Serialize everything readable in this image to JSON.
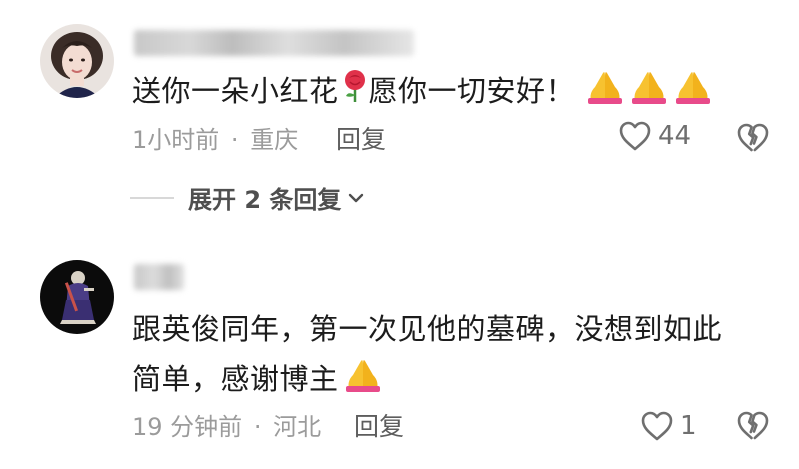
{
  "comments": [
    {
      "text": "送你一朵小红花",
      "text2": "愿你一切安好！",
      "time": "1小时前",
      "sep": "·",
      "location": "重庆",
      "reply_label": "回复",
      "likes": "44",
      "inline_emoji": "rose-emoji",
      "trailing_emoji": [
        "folded-hands-emoji",
        "folded-hands-emoji",
        "folded-hands-emoji"
      ]
    },
    {
      "line1": "跟英俊同年，第一次见他的墓碑，没想到如此",
      "line2": "简单，感谢博主",
      "time": "19 分钟前",
      "sep": "·",
      "location": "河北",
      "reply_label": "回复",
      "likes": "1",
      "trailing_emoji": [
        "folded-hands-emoji"
      ]
    }
  ],
  "expand_replies": {
    "label": "展开 2 条回复"
  },
  "colors": {
    "text": "#1c1c1c",
    "meta": "#9b9b9b",
    "icon": "#6f6f6f"
  }
}
